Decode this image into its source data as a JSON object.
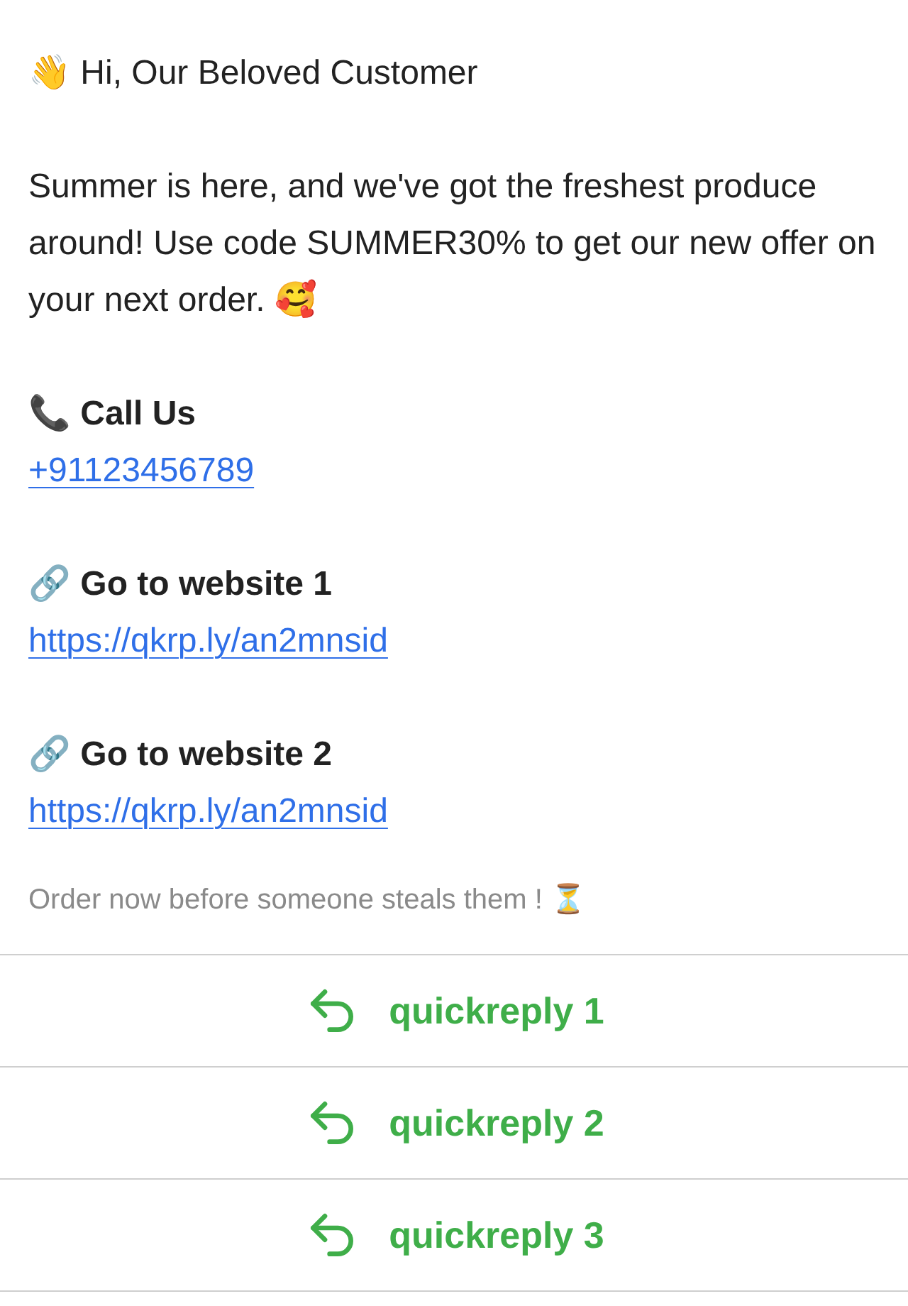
{
  "greeting": "👋 Hi, Our Beloved Customer",
  "body": "Summer is here, and we've got the freshest produce around! Use code SUMMER30% to get our new offer on your next order. 🥰",
  "contacts": [
    {
      "heading": "📞 Call Us",
      "link": "+91123456789"
    },
    {
      "heading": "🔗 Go to website 1",
      "link": "https://qkrp.ly/an2mnsid"
    },
    {
      "heading": "🔗 Go to website 2",
      "link": "https://qkrp.ly/an2mnsid"
    }
  ],
  "footer": "Order now before someone steals them ! ⏳",
  "quick_replies": [
    {
      "label": "quickreply 1"
    },
    {
      "label": "quickreply 2"
    },
    {
      "label": "quickreply 3"
    }
  ]
}
